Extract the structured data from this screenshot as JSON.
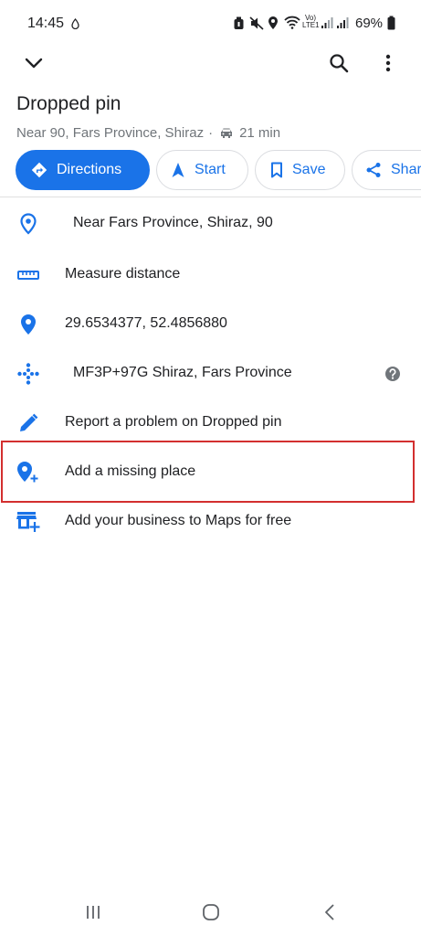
{
  "status_bar": {
    "time": "14:45",
    "battery": "69%",
    "network_label": "Vo) LTE1"
  },
  "top_bar": {
    "collapse_icon": "chevron-down-icon",
    "search_icon": "search-icon",
    "more_icon": "more-vert-icon"
  },
  "place": {
    "title": "Dropped pin",
    "subtitle_location": "Near 90, Fars Province, Shiraz",
    "subtitle_separator": "·",
    "drive_time": "21 min"
  },
  "actions": {
    "directions": "Directions",
    "start": "Start",
    "save": "Save",
    "share": "Share"
  },
  "rows": [
    {
      "icon": "location-pin-outline-icon",
      "text": "Near Fars Province, Shiraz, 90"
    },
    {
      "icon": "ruler-icon",
      "text": "Measure distance"
    },
    {
      "icon": "location-pin-icon",
      "text": "29.6534377, 52.4856880"
    },
    {
      "icon": "plus-code-icon",
      "text": "MF3P+97G Shiraz, Fars Province"
    },
    {
      "icon": "pencil-icon",
      "text": "Report a problem on Dropped pin"
    },
    {
      "icon": "add-location-icon",
      "text": "Add a missing place"
    },
    {
      "icon": "add-business-icon",
      "text": "Add your business to Maps for free"
    }
  ],
  "colors": {
    "accent": "#1a73e8",
    "text_primary": "#202124",
    "text_secondary": "#70757a",
    "highlight": "#d32f2f"
  }
}
